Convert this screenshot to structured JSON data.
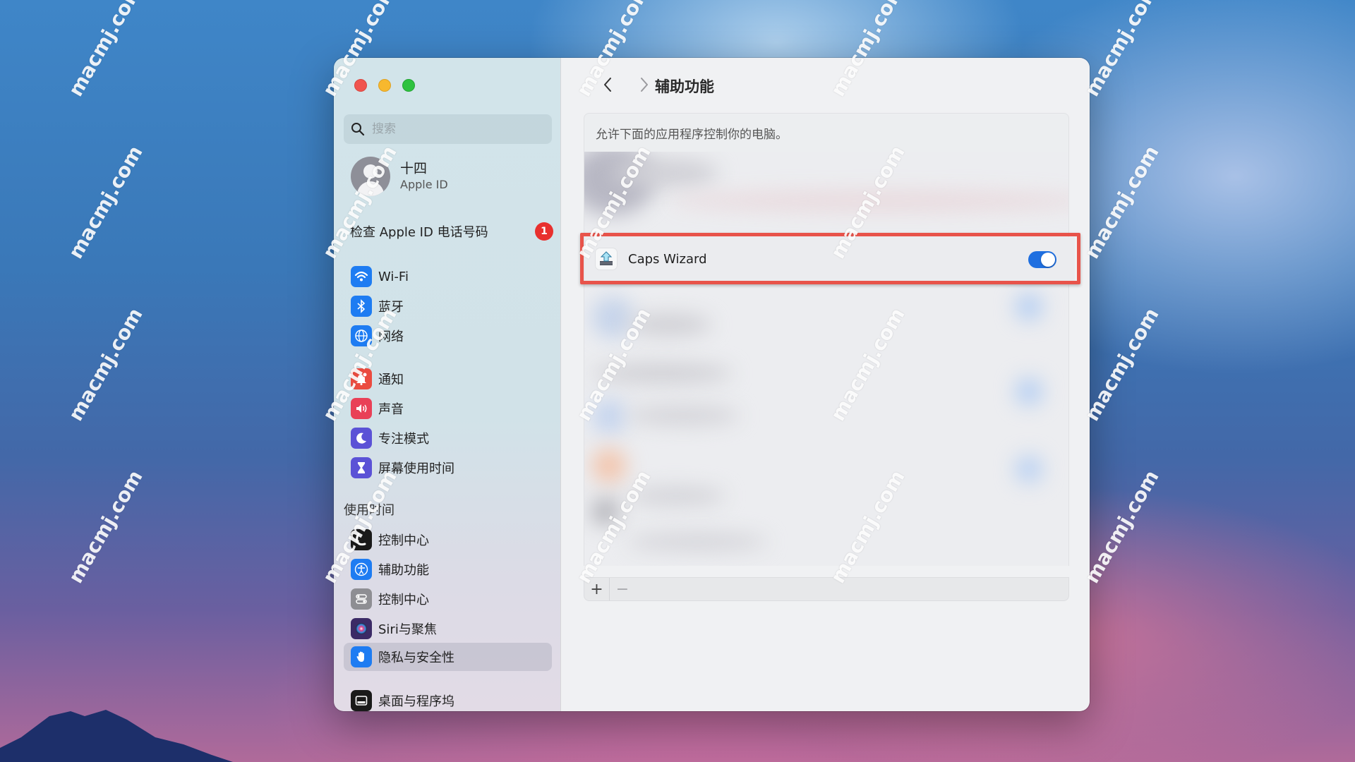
{
  "watermark": "macmj.com",
  "window": {
    "controls": {
      "close": "close-button",
      "minimize": "minimize-button",
      "maximize": "maximize-button"
    }
  },
  "sidebar": {
    "search_placeholder": "搜索",
    "profile": {
      "name": "十四",
      "subtitle": "Apple ID"
    },
    "check_apple_id": {
      "label": "检查 Apple ID 电话号码",
      "badge": "1"
    },
    "items": [
      {
        "label": "Wi-Fi",
        "icon": "wifi-icon",
        "color": "#1e7cf2"
      },
      {
        "label": "蓝牙",
        "icon": "bluetooth-icon",
        "color": "#1e7cf2"
      },
      {
        "label": "网络",
        "icon": "globe-icon",
        "color": "#1e7cf2"
      },
      {
        "label": "通知",
        "icon": "bell-icon",
        "color": "#eb4b3f"
      },
      {
        "label": "声音",
        "icon": "speaker-icon",
        "color": "#e94057"
      },
      {
        "label": "专注模式",
        "icon": "moon-icon",
        "color": "#5b52d6"
      },
      {
        "label": "屏幕使用时间",
        "icon": "hourglass-icon",
        "color": "#5b52d6"
      },
      {
        "section": "使用时间"
      },
      {
        "label": "控制中心",
        "icon": "control-center-dark-icon",
        "color": "#1a1a1a"
      },
      {
        "label": "辅助功能",
        "icon": "accessibility-icon",
        "color": "#1e7cf2"
      },
      {
        "label": "控制中心",
        "icon": "control-center-icon",
        "color": "#8e8e93"
      },
      {
        "label": "Siri与聚焦",
        "icon": "siri-icon",
        "color": "#3b2a66"
      },
      {
        "label": "隐私与安全性",
        "icon": "hand-icon",
        "color": "#1e7cf2",
        "selected": true
      },
      {
        "label": "桌面与程序坞",
        "icon": "dock-icon",
        "color": "#1a1a1a"
      }
    ]
  },
  "main": {
    "title": "辅助功能",
    "description": "允许下面的应用程序控制你的电脑。",
    "apps": [
      {
        "name": "Caps Wizard",
        "icon": "caps-wizard-icon",
        "enabled": true,
        "highlighted": true
      }
    ],
    "add_label": "+",
    "remove_label": "−"
  },
  "colors": {
    "accent": "#1f6fe0",
    "highlight": "#e8534a",
    "badge": "#e8302e"
  }
}
